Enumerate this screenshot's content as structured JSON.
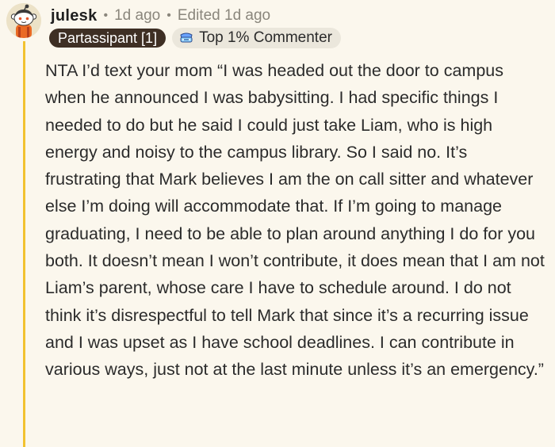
{
  "comment": {
    "username": "julesk",
    "posted": "1d ago",
    "edited": "Edited 1d ago",
    "separator": "•",
    "flair": "Partassipant [1]",
    "achievement": {
      "label": "Top 1% Commenter",
      "icon": "commenter-badge-icon"
    },
    "avatar_icon": "snoo-avatar-icon",
    "body": "NTA I’d text your mom “I was headed out the door to campus when he announced I was babysitting. I had specific things I needed to do but he said I could just take Liam, who is high energy and noisy to the campus library. So I said no. It’s frustrating that Mark believes I am the on call sitter and whatever else I’m doing will accommodate that. If I’m going to manage graduating, I need to be able to plan around anything I do for you both. It doesn’t mean I won’t contribute, it does mean that I am not Liam’s parent, whose care I have to schedule around. I do not think it’s disrespectful to tell Mark that since it’s a recurring issue and I was upset as I have school deadlines. I can contribute in various ways, just not at the last minute unless it’s an emergency.”"
  },
  "colors": {
    "background": "#fbf7ed",
    "thread_line": "#f2c230",
    "flair_bg": "#3e2f24",
    "achievement_bg": "#ebe7dc",
    "meta_text": "#8a867c"
  }
}
